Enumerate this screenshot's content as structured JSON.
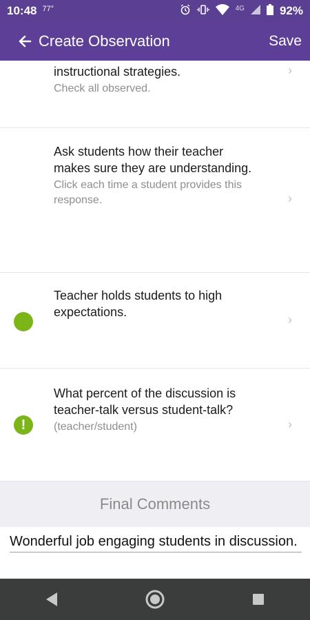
{
  "status_bar": {
    "time": "10:48",
    "temp": "77°",
    "battery": "92%",
    "network": "4G"
  },
  "app_bar": {
    "title": "Create Observation",
    "save_label": "Save"
  },
  "items": [
    {
      "main": "instructional strategies.",
      "sub": "Check all observed."
    },
    {
      "main": "Ask students how their teacher makes sure they are understanding.",
      "sub": "Click each time a student provides this response."
    },
    {
      "main": "Teacher holds students to high expectations.",
      "sub": "",
      "indicator": "green-dot"
    },
    {
      "main": "What percent of the discussion is teacher-talk versus student-talk?",
      "sub": "(teacher/student)",
      "indicator": "alert-icon"
    }
  ],
  "final_comments": {
    "header": "Final Comments",
    "value": "Wonderful job engaging students in discussion."
  },
  "colors": {
    "primary": "#5e3f98",
    "accent_green": "#7cb518"
  }
}
